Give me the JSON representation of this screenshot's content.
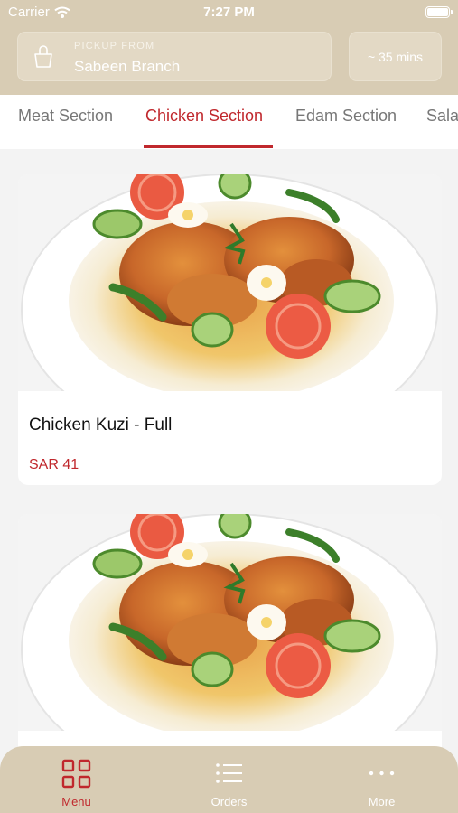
{
  "status_bar": {
    "carrier": "Carrier",
    "time": "7:27 PM"
  },
  "pickup": {
    "label": "PICKUP FROM",
    "branch": "Sabeen Branch"
  },
  "eta": "~ 35 mins",
  "tabs": [
    {
      "label": "Meat Section"
    },
    {
      "label": "Chicken Section"
    },
    {
      "label": "Edam Section"
    },
    {
      "label": "Sala"
    }
  ],
  "active_tab": "Chicken Section",
  "products": [
    {
      "name": "Chicken Kuzi - Full",
      "price": "SAR 41"
    },
    {
      "name": "",
      "price": ""
    }
  ],
  "tabbar": [
    {
      "label": "Menu",
      "icon": "grid-icon"
    },
    {
      "label": "Orders",
      "icon": "list-icon"
    },
    {
      "label": "More",
      "icon": "more-dots-icon"
    }
  ],
  "colors": {
    "header": "#d8ccb4",
    "accent": "#c0282d",
    "background": "#f3f3f3"
  }
}
